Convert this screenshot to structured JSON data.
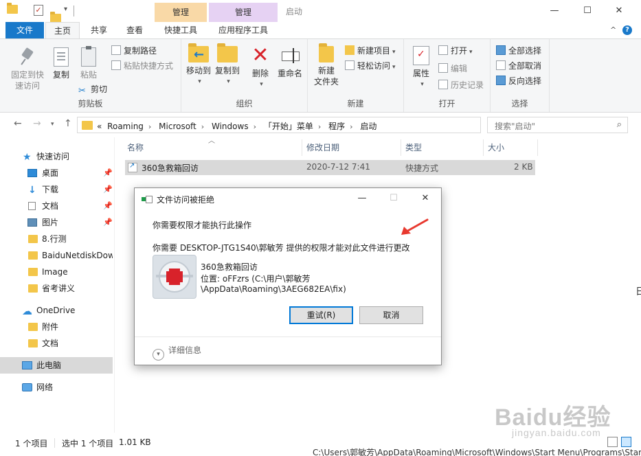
{
  "titlebar": {
    "window_title": "启动",
    "context_header_1": "管理",
    "context_header_2": "管理",
    "controls": {
      "minimize": "—",
      "maximize": "☐",
      "close": "✕"
    },
    "colors": {
      "context_1": "#f9d9a7",
      "context_2": "#e6d2f3",
      "file_tab": "#1979ca"
    }
  },
  "ribbon_tabs": {
    "file": "文件",
    "home": "主页",
    "share": "共享",
    "view": "查看",
    "shortcut_tools": "快捷工具",
    "app_tools": "应用程序工具",
    "collapse": "^",
    "help": "?"
  },
  "ribbon": {
    "clipboard": {
      "group_label": "剪贴板",
      "pin_quick_access": "固定到快\n速访问",
      "pin_line1": "固定到快",
      "pin_line2": "速访问",
      "copy": "复制",
      "paste": "粘贴",
      "copy_path": "复制路径",
      "paste_shortcut": "粘贴快捷方式",
      "cut": "剪切"
    },
    "organize": {
      "group_label": "组织",
      "move_to": "移动到",
      "copy_to": "复制到",
      "delete": "删除",
      "rename": "重命名"
    },
    "new": {
      "group_label": "新建",
      "new_folder_line1": "新建",
      "new_folder_line2": "文件夹",
      "new_item": "新建项目",
      "easy_access": "轻松访问"
    },
    "open": {
      "group_label": "打开",
      "properties": "属性",
      "open": "打开",
      "edit": "编辑",
      "history": "历史记录"
    },
    "select": {
      "group_label": "选择",
      "select_all": "全部选择",
      "select_none": "全部取消",
      "invert": "反向选择"
    }
  },
  "address": {
    "segments": [
      "Roaming",
      "Microsoft",
      "Windows",
      "「开始」菜单",
      "程序",
      "启动"
    ],
    "prefix": "«",
    "search_placeholder": "搜索\"启动\""
  },
  "nav_pane": {
    "quick_access": "快速访问",
    "desktop": "桌面",
    "downloads": "下载",
    "documents": "文档",
    "pictures": "图片",
    "f_8": "8.行测",
    "f_baidu": "BaiduNetdiskDow",
    "f_image": "Image",
    "f_notes": "省考讲义",
    "onedrive": "OneDrive",
    "od_attach": "附件",
    "od_docs": "文档",
    "this_pc": "此电脑",
    "network": "网络"
  },
  "file_list": {
    "columns": {
      "name": "名称",
      "modified": "修改日期",
      "type": "类型",
      "size": "大小"
    },
    "rows": [
      {
        "name": "360急救箱回访",
        "modified": "2020-7-12 7:41",
        "type": "快捷方式",
        "size": "2 KB"
      }
    ]
  },
  "status_bar": {
    "item_count": "1 个项目",
    "selected": "选中 1 个项目",
    "selected_size": "1.01 KB"
  },
  "background": {
    "path_text": "C:\\Users\\郭敏芳\\AppData\\Roaming\\Microsoft\\Windows\\Start Menu\\Programs\\Startup\\3",
    "edge_char": "日",
    "watermark": "Baidu经验",
    "watermark_sub": "jingyan.baidu.com"
  },
  "dialog": {
    "title": "文件访问被拒绝",
    "message_1": "你需要权限才能执行此操作",
    "message_2": "你需要 DESKTOP-JTG1S40\\郭敏芳 提供的权限才能对此文件进行更改",
    "file_name": "360急救箱回访",
    "location_line1": "位置: oFFzrs (C:\\用户\\郭敏芳",
    "location_line2": "\\AppData\\Roaming\\3AEG682EA\\fix)",
    "retry_button": "重试(R)",
    "cancel_button": "取消",
    "details": "详细信息",
    "controls": {
      "minimize": "—",
      "maximize": "☐",
      "close": "✕"
    }
  },
  "annotation": {
    "arrow_color": "#e8392f"
  }
}
